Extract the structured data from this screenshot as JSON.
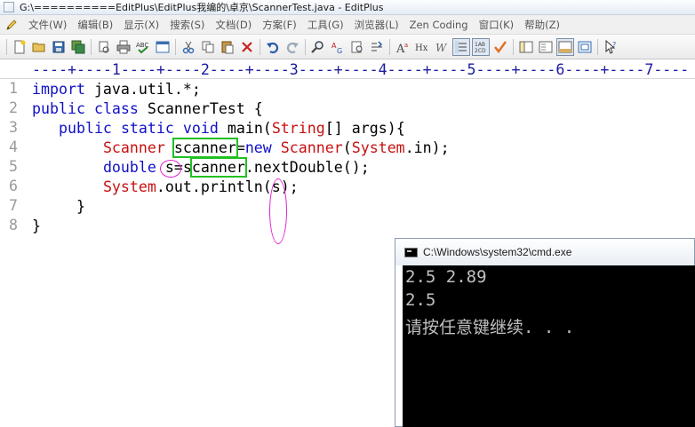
{
  "window": {
    "title": "G:\\==========EditPlus\\EditPlus我编的\\卓京\\ScannerTest.java - EditPlus"
  },
  "menu": {
    "items": [
      "文件(W)",
      "编辑(B)",
      "显示(X)",
      "搜索(S)",
      "文档(D)",
      "方案(F)",
      "工具(G)",
      "浏览器(L)",
      "Zen Coding",
      "窗口(K)",
      "帮助(Z)"
    ]
  },
  "ruler": {
    "text": "----+----1----+----2----+----3----+----4----+----5----+----6----+----7----"
  },
  "editor": {
    "line_numbers": [
      "1",
      "2",
      "3",
      "4",
      "5",
      "6",
      "7",
      "8"
    ],
    "lines": {
      "l1": {
        "kw": "import",
        "rest": " java.util.*;"
      },
      "l2": {
        "kw1": "public",
        "kw2": "class",
        "rest": " ScannerTest {"
      },
      "l3": {
        "kw1": "public",
        "kw2": "static",
        "kw3": "void",
        "pre": " main(",
        "cls": "String",
        "post": "[] args){"
      },
      "l4": {
        "cls1": "Scanner",
        "boxed": "scanner",
        "op": "=",
        "kw": "new",
        "cls2": "Scanner",
        "paren": "(",
        "cls3": "System",
        "post": ".in);"
      },
      "l5": {
        "kw": "double",
        "var": "s",
        "op": "=s",
        "boxed": "canner",
        "post": ".nextDouble();"
      },
      "l6": {
        "cls": "System",
        "pre": ".out.println(",
        "var": "s",
        "post": ");"
      },
      "l7": {
        "text": "}"
      },
      "l8": {
        "text": "}"
      }
    }
  },
  "console": {
    "title": "C:\\Windows\\system32\\cmd.exe",
    "lines": [
      "2.5 2.89",
      "2.5",
      "请按任意键继续. . ."
    ]
  },
  "colors": {
    "keyword": "#1010c8",
    "class": "#c81010",
    "annotation_box": "#22c022",
    "annotation_ellipse": "#e020d0"
  }
}
